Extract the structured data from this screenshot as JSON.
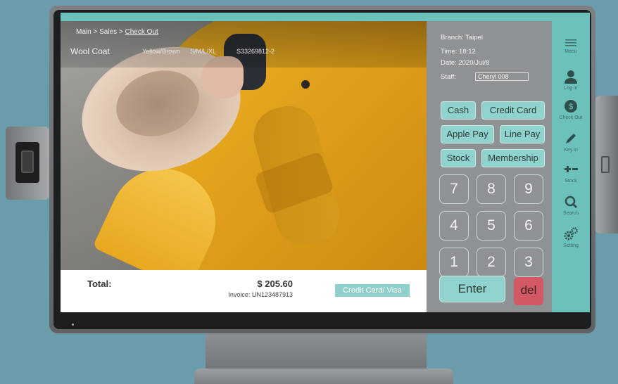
{
  "breadcrumb": {
    "main": "Main",
    "sep1": " > ",
    "sales": "Sales",
    "sep2": " > ",
    "current": "Check Out"
  },
  "product": {
    "name": "Wool Coat",
    "color": "Yellow/Brown",
    "sizes": "S/M/L/XL",
    "sku": "S33269812-2"
  },
  "totals": {
    "label": "Total:",
    "amount": "$ 205.60",
    "invoice": "Invoice: UN123487913",
    "payment_method": "Credit Card/ Visa"
  },
  "info": {
    "branch": "Branch: Taipei",
    "time": "Time: 18:12",
    "date": "Date: 2020/Jul/8",
    "staff_label": "Staff:",
    "staff_value": "Cheryl 008"
  },
  "payment_buttons": {
    "cash": "Cash",
    "credit_card": "Credit Card",
    "apple_pay": "Apple Pay",
    "line_pay": "Line Pay",
    "stock": "Stock",
    "membership": "Membership"
  },
  "keypad": {
    "k7": "7",
    "k8": "8",
    "k9": "9",
    "k4": "4",
    "k5": "5",
    "k6": "6",
    "k1": "1",
    "k2": "2",
    "k3": "3",
    "enter": "Enter",
    "del": "del"
  },
  "sidebar": {
    "menu": "Menu",
    "login": "Log in",
    "checkout": "Check Out",
    "checkout_symbol": "$",
    "keyin": "Key in",
    "stock": "Stock",
    "search": "Search",
    "setting": "Setting"
  },
  "colors": {
    "accent": "#6dc1bb",
    "button": "#8fd3cc",
    "panel": "#8e9295",
    "delete": "#d35866",
    "coat": "#e0a01a"
  }
}
